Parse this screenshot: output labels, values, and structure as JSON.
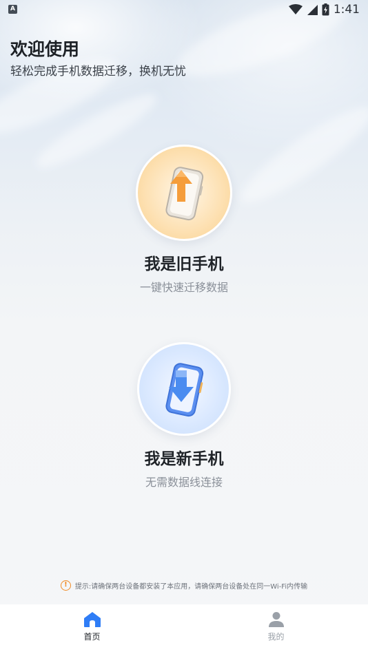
{
  "status_bar": {
    "notification_badge": "A",
    "time": "1:41",
    "icons": [
      "wifi-icon",
      "signal-icon",
      "battery-icon"
    ]
  },
  "header": {
    "title": "欢迎使用",
    "subtitle": "轻松完成手机数据迁移，换机无忧"
  },
  "options": {
    "old_phone": {
      "title": "我是旧手机",
      "description": "一键快速迁移数据",
      "icon": "phone-upload-icon"
    },
    "new_phone": {
      "title": "我是新手机",
      "description": "无需数据线连接",
      "icon": "phone-download-icon"
    }
  },
  "tip": {
    "icon": "info-icon",
    "symbol": "!",
    "text": "提示:请确保两台设备都安装了本应用，请确保两台设备处在同一Wi-Fi内传输"
  },
  "bottom_nav": {
    "items": [
      {
        "label": "首页",
        "icon": "home-icon",
        "active": true
      },
      {
        "label": "我的",
        "icon": "user-icon",
        "active": false
      }
    ]
  },
  "colors": {
    "accent": "#2f7df6",
    "old_phone_accent": "#f7a23a",
    "new_phone_accent": "#4a8cf0",
    "tip_icon": "#f08a24"
  }
}
